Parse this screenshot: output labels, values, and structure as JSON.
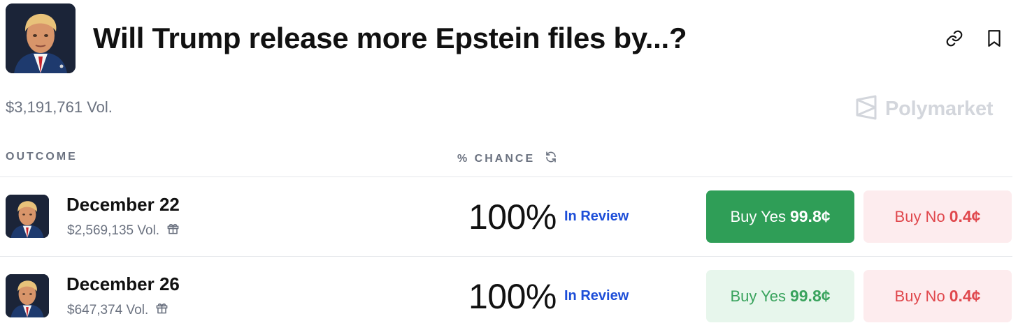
{
  "market": {
    "title": "Will Trump release more Epstein files by...?",
    "volume": "$3,191,761 Vol."
  },
  "brand": {
    "name": "Polymarket"
  },
  "icons": {
    "share": "link-icon",
    "save": "bookmark-icon",
    "refresh": "refresh-icon",
    "rewards": "gift-icon",
    "brand": "polymarket-logo-icon"
  },
  "table": {
    "outcome_header": "OUTCOME",
    "chance_header": "% CHANCE"
  },
  "outcomes": [
    {
      "title": "December 22",
      "volume": "$2,569,135 Vol.",
      "chance": "100%",
      "status": "In Review",
      "buy_yes_label": "Buy Yes",
      "buy_yes_price": "99.8¢",
      "buy_no_label": "Buy No",
      "buy_no_price": "0.4¢"
    },
    {
      "title": "December 26",
      "volume": "$647,374 Vol.",
      "chance": "100%",
      "status": "In Review",
      "buy_yes_label": "Buy Yes",
      "buy_yes_price": "99.8¢",
      "buy_no_label": "Buy No",
      "buy_no_price": "0.4¢"
    }
  ],
  "colors": {
    "yes_active": "#2f9e57",
    "yes_soft": "#e7f6ec",
    "no_soft": "#fdecee",
    "no_text": "#e0484d",
    "status_blue": "#1d4ed8"
  }
}
